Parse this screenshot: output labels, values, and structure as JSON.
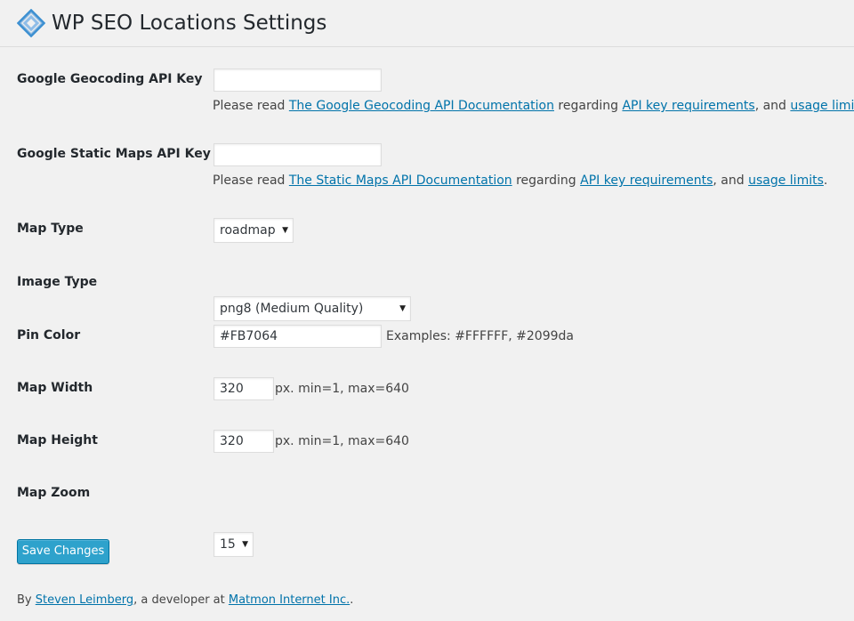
{
  "page": {
    "title": "WP SEO Locations Settings",
    "logo_icon": "wp-seo-locations-logo-icon"
  },
  "geocoding": {
    "label": "Google Geocoding API Key",
    "value": "",
    "desc_prefix": "Please read ",
    "doc_link": "The Google Geocoding API Documentation",
    "desc_mid": " regarding ",
    "req_link": "API key requirements",
    "desc_and": ", and ",
    "limits_link": "usage limits",
    "desc_end": "."
  },
  "static_maps": {
    "label": "Google Static Maps API Key",
    "value": "",
    "desc_prefix": "Please read ",
    "doc_link": "The Static Maps API Documentation",
    "desc_mid": " regarding ",
    "req_link": "API key requirements",
    "desc_and": ", and ",
    "limits_link": "usage limits",
    "desc_end": "."
  },
  "map_type": {
    "label": "Map Type",
    "selected": "roadmap"
  },
  "image_type": {
    "label": "Image Type",
    "selected": "png8 (Medium Quality)"
  },
  "pin_color": {
    "label": "Pin Color",
    "value": "#FB7064",
    "note": "Examples: #FFFFFF, #2099da"
  },
  "map_width": {
    "label": "Map Width",
    "value": "320",
    "note": "px. min=1, max=640"
  },
  "map_height": {
    "label": "Map Height",
    "value": "320",
    "note": "px. min=1, max=640"
  },
  "map_zoom": {
    "label": "Map Zoom",
    "selected": "15"
  },
  "save_label": "Save Changes",
  "footer": {
    "prefix": "By ",
    "author_link": "Steven Leimberg",
    "mid": ", a developer at ",
    "company_link": "Matmon Internet Inc.",
    "end": "."
  },
  "colors": {
    "background": "#f1f1f1",
    "link": "#0073aa",
    "button": "#2ea2cc",
    "logo_blue": "#3b8fd1"
  }
}
